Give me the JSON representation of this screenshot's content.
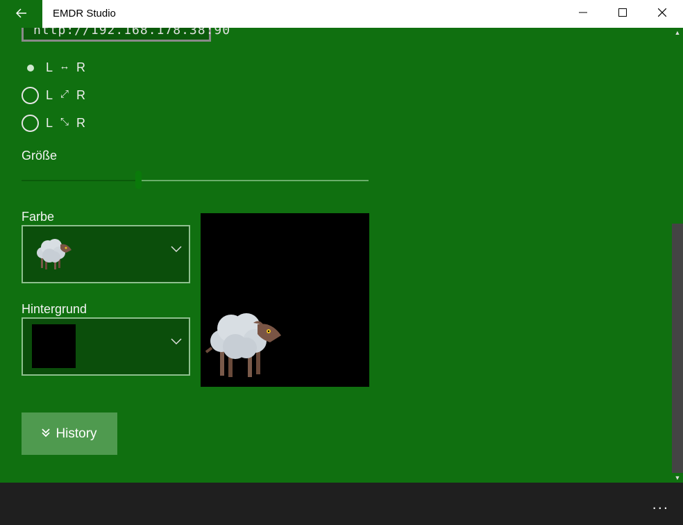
{
  "window": {
    "title": "EMDR Studio",
    "back_icon": "arrow-left-icon",
    "minimize_icon": "minimize-icon",
    "maximize_icon": "maximize-icon",
    "close_icon": "close-icon"
  },
  "server": {
    "url": "http://192.168.178.38:90"
  },
  "direction": {
    "options": [
      {
        "left": "L",
        "arrow": "↔",
        "right": "R",
        "checked": true
      },
      {
        "left": "L",
        "arrow": "⤢",
        "right": "R",
        "checked": false
      },
      {
        "left": "L",
        "arrow": "⤡",
        "right": "R",
        "checked": false
      }
    ]
  },
  "size": {
    "label": "Größe",
    "value": 0.34
  },
  "color": {
    "label": "Farbe",
    "selected_icon": "sheep-icon"
  },
  "background": {
    "label": "Hintergrund",
    "selected_color": "#000000"
  },
  "history": {
    "label": "History",
    "icon": "double-chevron-down-icon"
  },
  "bottom": {
    "more": "..."
  },
  "colors": {
    "accent": "#107010",
    "bottom_bar": "#1f1f1f"
  }
}
